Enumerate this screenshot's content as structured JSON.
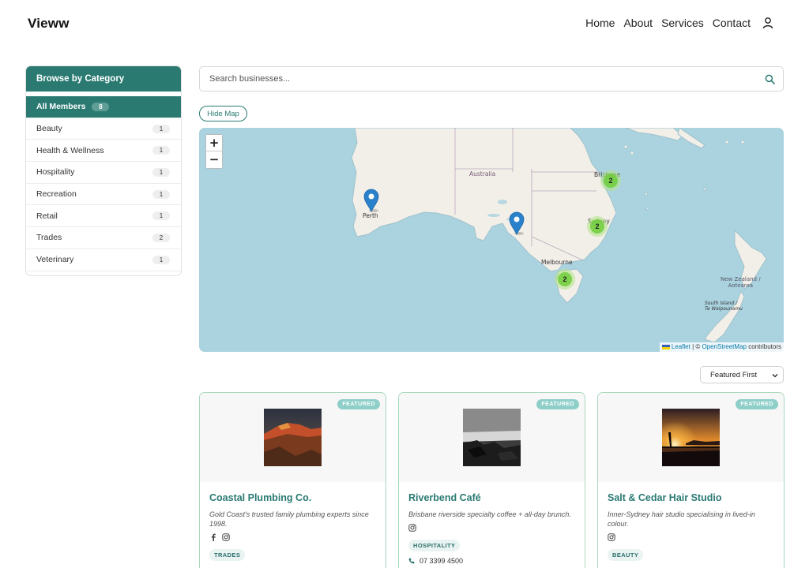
{
  "brand": {
    "logo": "Vieww"
  },
  "nav": {
    "items": [
      "Home",
      "About",
      "Services",
      "Contact"
    ],
    "user_icon": "user-icon"
  },
  "sidebar": {
    "title": "Browse by Category",
    "items": [
      {
        "label": "All Members",
        "count": "8",
        "active": true
      },
      {
        "label": "Beauty",
        "count": "1"
      },
      {
        "label": "Health & Wellness",
        "count": "1"
      },
      {
        "label": "Hospitality",
        "count": "1"
      },
      {
        "label": "Recreation",
        "count": "1"
      },
      {
        "label": "Retail",
        "count": "1"
      },
      {
        "label": "Trades",
        "count": "2"
      },
      {
        "label": "Veterinary",
        "count": "1"
      }
    ]
  },
  "search": {
    "placeholder": "Search businesses...",
    "value": "",
    "icon": "search-icon"
  },
  "map": {
    "hide_label": "Hide Map",
    "zoom_in": "+",
    "zoom_out": "−",
    "labels": {
      "australia": "Australia",
      "perth": "Perth",
      "melbourne": "Melbourne",
      "brisbane": "Brisbane",
      "sydney": "Sydney",
      "nz_line1": "New Zealand /",
      "nz_line2": "Aotearoa",
      "si_line1": "South Island /",
      "si_line2": "Te Waipounamu"
    },
    "clusters": [
      "2",
      "2",
      "2"
    ],
    "attribution": {
      "leaflet": "Leaflet",
      "separator": " | © ",
      "osm": "OpenStreetMap",
      "suffix": " contributors"
    },
    "colors": {
      "water": "#aad3df",
      "land": "#f2efe9",
      "marker": "#2a81cb",
      "cluster": "#6ecc39"
    }
  },
  "sort": {
    "selected": "Featured First"
  },
  "cards": [
    {
      "badge": "FEATURED",
      "title": "Coastal Plumbing Co.",
      "description": "Gold Coast's trusted family plumbing experts since 1998.",
      "socials": [
        "facebook-icon",
        "instagram-icon"
      ],
      "tag": "TRADES"
    },
    {
      "badge": "FEATURED",
      "title": "Riverbend Café",
      "description": "Brisbane riverside specialty coffee + all-day brunch.",
      "socials": [
        "instagram-icon"
      ],
      "tag": "HOSPITALITY",
      "phone": "07 3399 4500"
    },
    {
      "badge": "FEATURED",
      "title": "Salt & Cedar Hair Studio",
      "description": "Inner-Sydney hair studio specialising in lived-in colour.",
      "socials": [
        "instagram-icon"
      ],
      "tag": "BEAUTY"
    }
  ],
  "theme": {
    "accent": "#2a7a72",
    "accent_light": "#8fcfc9",
    "card_border": "#a9d8be"
  }
}
